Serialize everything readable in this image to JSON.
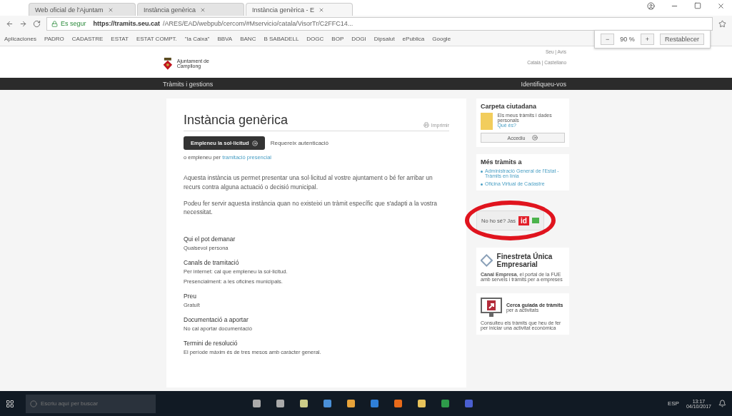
{
  "browser": {
    "tabs": [
      {
        "label": "Web oficial de l'Ajuntam",
        "selected": false
      },
      {
        "label": "Instància genèrica",
        "selected": false
      },
      {
        "label": "Instància genèrica - E",
        "selected": true
      }
    ],
    "secure_label": "Es segur",
    "url_host": "https://tramits.seu.cat",
    "url_path": "/ARES/EAD/webpub/cercom/#Mservicio/catala/VisorTr/C2FFC14...",
    "bookmarks": [
      "Aplicaciones",
      "PADRO",
      "CADASTRE",
      "ESTAT",
      "ESTAT COMPT.",
      "\"la Caixa\"",
      "BBVA",
      "BANC",
      "B SABADELL",
      "DOGC",
      "BOP",
      "DOGI",
      "Dipsalut",
      "ePublica",
      "Google"
    ],
    "zoom": {
      "minus": "−",
      "value": "90 %",
      "plus": "+",
      "reset": "Restablecer"
    }
  },
  "site": {
    "org_name": "Ajuntament de Campllong",
    "top_links": "Seu | Avís",
    "languages": "Català | Castellano",
    "nav_left": "Tràmits i gestions",
    "nav_right": "Identifiqueu-vos"
  },
  "main": {
    "title": "Instància genèrica",
    "print": "Imprimir",
    "start_button": "Empleneu la sol·licitud",
    "auth_note": "Requereix autenticació",
    "alt_prefix": "o empleneu per ",
    "alt_link": "tramitació presencial",
    "paragraphs": [
      "Aquesta instància us permet presentar una sol·licitud al vostre ajuntament o bé fer arribar un recurs contra alguna actuació o decisió municipal.",
      "Podeu fer servir aquesta instància quan no existeixi un tràmit específic que s'adapti a la vostra necessitat."
    ],
    "sections": [
      {
        "heading": "Qui el pot demanar",
        "lines": [
          "Qualsevol persona"
        ]
      },
      {
        "heading": "Canals de tramitació",
        "lines": [
          "Per internet: cal que empleneu la sol·licitud.",
          "Presencialment: a les oficines municipals."
        ]
      },
      {
        "heading": "Preu",
        "lines": [
          "Gratuït"
        ]
      },
      {
        "heading": "Documentació a aportar",
        "lines": [
          "No cal aportar documentació"
        ]
      },
      {
        "heading": "Termini de resolució",
        "lines": [
          "El període màxim és de tres mesos amb caràcter general."
        ]
      }
    ]
  },
  "sidebar": {
    "folder": {
      "title": "Carpeta ciutadana",
      "text": "Els meus tràmits i dades personals",
      "link": "Què és?",
      "button": "Accediu"
    },
    "more": {
      "title": "Més tràmits a",
      "links": [
        "Administració General de l'Estat - Tràmits en línia",
        "Oficina Virtual de Cadastre"
      ]
    },
    "idcat": {
      "text": "No ho sé? Jas",
      "badge": "id"
    },
    "fue": {
      "title": "Finestreta Única Empresarial",
      "desc_bold": "Canal Empresa",
      "desc": ", el portal de la FUE amb serveis i tràmits per a empreses"
    },
    "guide": {
      "title": "Cerca guiada de tràmits",
      "subtitle": "per a activitats",
      "desc": "Consulteu els tràmits que heu de fer per iniciar una activitat econòmica"
    }
  },
  "taskbar": {
    "search_placeholder": "Escriu aquí per buscar",
    "language": "ESP",
    "time": "13:17",
    "date": "04/10/2017"
  }
}
